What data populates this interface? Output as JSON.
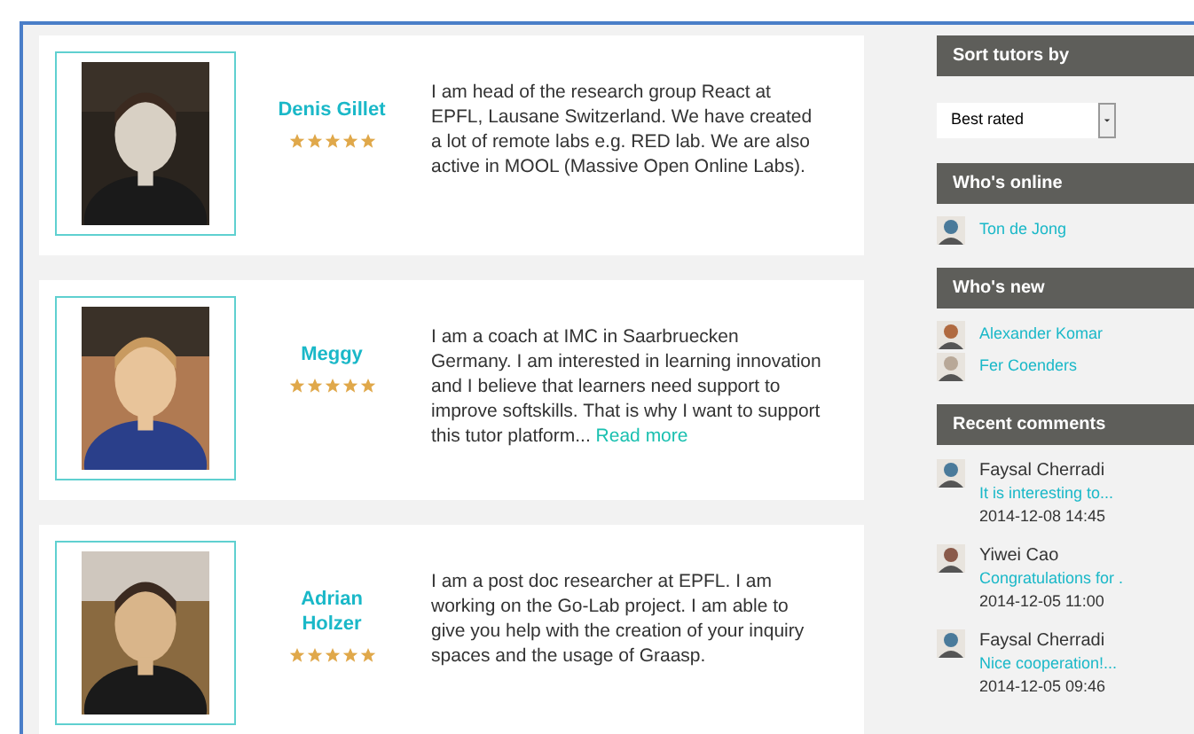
{
  "tutors": [
    {
      "name": "Denis Gillet",
      "stars": 5,
      "bio": "I am head of the research group React at EPFL, Lausane Switzerland. We have created a lot of remote labs e.g. RED lab. We are also active in MOOL (Massive Open Online Labs)."
    },
    {
      "name": "Meggy",
      "stars": 5,
      "bio": "I am a coach at IMC in Saarbruecken Germany. I am interested in learning innovation and I believe that learners need support to improve softskills. That is why I want to support this tutor platform...",
      "link": "Read more"
    },
    {
      "name": "Adrian Holzer",
      "stars": 5,
      "bio": "I am a post doc researcher at EPFL. I am working on the Go-Lab project. I am able to give you help with the creation of your inquiry spaces and the usage of Graasp."
    }
  ],
  "sidebar": {
    "sort": {
      "title": "Sort tutors by",
      "value": "Best rated"
    },
    "online": {
      "title": "Who's online",
      "users": [
        "Ton de Jong"
      ]
    },
    "new": {
      "title": "Who's new",
      "users": [
        "Alexander Komar",
        "Fer Coenders"
      ]
    },
    "comments": {
      "title": "Recent comments",
      "items": [
        {
          "author": "Faysal Cherradi",
          "text": "It is interesting to...",
          "date": "2014-12-08 14:45"
        },
        {
          "author": "Yiwei Cao",
          "text": "Congratulations for .",
          "date": "2014-12-05 11:00"
        },
        {
          "author": "Faysal Cherradi",
          "text": "Nice cooperation!...",
          "date": "2014-12-05 09:46"
        }
      ]
    }
  }
}
